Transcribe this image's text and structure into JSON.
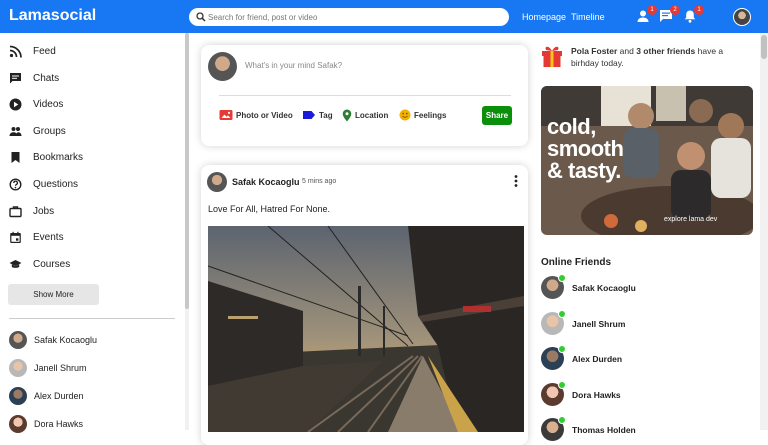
{
  "app": {
    "logo": "Lamasocial"
  },
  "topbar": {
    "search_placeholder": "Search for friend, post or video",
    "links": [
      "Homepage",
      "Timeline"
    ],
    "badges": {
      "person": "1",
      "chat": "2",
      "notifications": "1"
    }
  },
  "sidebar": {
    "items": [
      {
        "label": "Feed",
        "icon": "rss-icon"
      },
      {
        "label": "Chats",
        "icon": "chat-icon"
      },
      {
        "label": "Videos",
        "icon": "play-circle-icon"
      },
      {
        "label": "Groups",
        "icon": "group-icon"
      },
      {
        "label": "Bookmarks",
        "icon": "bookmark-icon"
      },
      {
        "label": "Questions",
        "icon": "help-circle-icon"
      },
      {
        "label": "Jobs",
        "icon": "briefcase-icon"
      },
      {
        "label": "Events",
        "icon": "calendar-icon"
      },
      {
        "label": "Courses",
        "icon": "graduation-cap-icon"
      }
    ],
    "show_more": "Show More",
    "friends": [
      "Safak Kocaoglu",
      "Janell Shrum",
      "Alex Durden",
      "Dora Hawks"
    ]
  },
  "share": {
    "placeholder": "What's in your mind Safak?",
    "options": [
      {
        "label": "Photo or Video",
        "icon": "photo-icon",
        "color": "#e53935"
      },
      {
        "label": "Tag",
        "icon": "tag-icon",
        "color": "#1a1adb"
      },
      {
        "label": "Location",
        "icon": "location-icon",
        "color": "#2e7d32"
      },
      {
        "label": "Feelings",
        "icon": "emoji-icon",
        "color": "#f2b100"
      }
    ],
    "button": "Share"
  },
  "post": {
    "username": "Safak Kocaoglu",
    "time": "5 mins ago",
    "text": "Love For All, Hatred For None."
  },
  "rightbar": {
    "birthday_name": "Pola Foster",
    "birthday_middle": " and ",
    "birthday_count": "3 other friends",
    "birthday_tail": " have a birhday today.",
    "ad_line1": "cold,",
    "ad_line2": "smooth",
    "ad_line3": "& tasty.",
    "ad_caption": "explore lama dev",
    "online_title": "Online Friends",
    "online": [
      "Safak Kocaoglu",
      "Janell Shrum",
      "Alex Durden",
      "Dora Hawks",
      "Thomas Holden"
    ]
  },
  "colors": {
    "brand": "#1877f2",
    "share_button": "#0a8f0a",
    "online": "#32cd32",
    "badge": "#e53935"
  }
}
